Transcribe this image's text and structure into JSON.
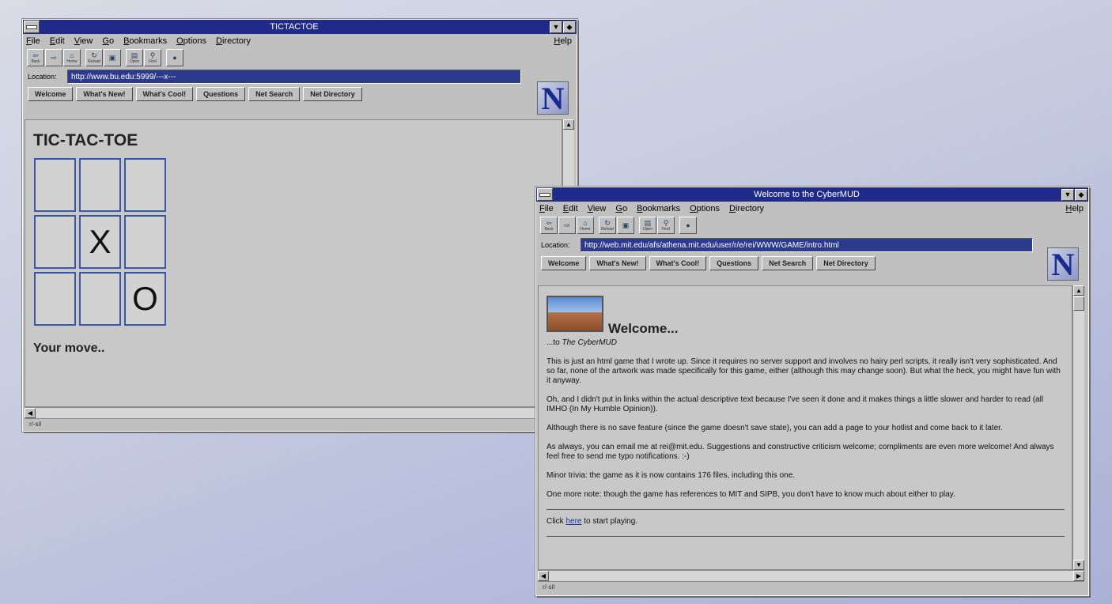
{
  "win1": {
    "title": "TICTACTOE",
    "menu": [
      "File",
      "Edit",
      "View",
      "Go",
      "Bookmarks",
      "Options",
      "Directory"
    ],
    "help": "Help",
    "toolbar": [
      "Back",
      "Forward",
      "Home",
      "Reload",
      "Images",
      "Open",
      "Find",
      "Stop"
    ],
    "location_label": "Location:",
    "location": "http://www.bu.edu:5999/---x---",
    "nav": [
      "Welcome",
      "What's New!",
      "What's Cool!",
      "Questions",
      "Net Search",
      "Net Directory"
    ],
    "page_title": "TIC-TAC-TOE",
    "board": [
      "",
      "",
      "",
      "",
      "X",
      "",
      "",
      "",
      "O"
    ],
    "prompt": "Your move..",
    "status": "r/-sil"
  },
  "win2": {
    "title": "Welcome to the CyberMUD",
    "menu": [
      "File",
      "Edit",
      "View",
      "Go",
      "Bookmarks",
      "Options",
      "Directory"
    ],
    "help": "Help",
    "toolbar": [
      "Back",
      "Forward",
      "Home",
      "Reload",
      "Images",
      "Open",
      "Find",
      "Stop"
    ],
    "location_label": "Location:",
    "location": "http://web.mit.edu/afs/athena.mit.edu/user/r/e/rei/WWW/GAME/intro.html",
    "nav": [
      "Welcome",
      "What's New!",
      "What's Cool!",
      "Questions",
      "Net Search",
      "Net Directory"
    ],
    "heading": "Welcome...",
    "to_prefix": "...to",
    "to_name": "The CyberMUD",
    "para1": "This is just an html game that I wrote up. Since it requires no server support and involves no hairy perl scripts, it really isn't very sophisticated. And so far, none of the artwork was made specifically for this game, either (although this may change soon). But what the heck, you might have fun with it anyway.",
    "para2": "Oh, and I didn't put in links within the actual descriptive text because I've seen it done and it makes things a little slower and harder to read (all IMHO (In My Humble Opinion)).",
    "para3": "Although there is no save feature (since the game doesn't save state), you can add a page to your hotlist and come back to it later.",
    "para4": "As always, you can email me at rei@mit.edu. Suggestions and constructive criticism welcome; compliments are even more welcome! And always feel free to send me typo notifications. :-)",
    "para5": "Minor trivia: the game as it is now contains 176 files, including this one.",
    "para6": "One more note: though the game has references to MIT and SIPB, you don't have to know much about either to play.",
    "click_prefix": "Click",
    "click_link": "here",
    "click_suffix": "to start playing.",
    "status": "r/-sil"
  }
}
